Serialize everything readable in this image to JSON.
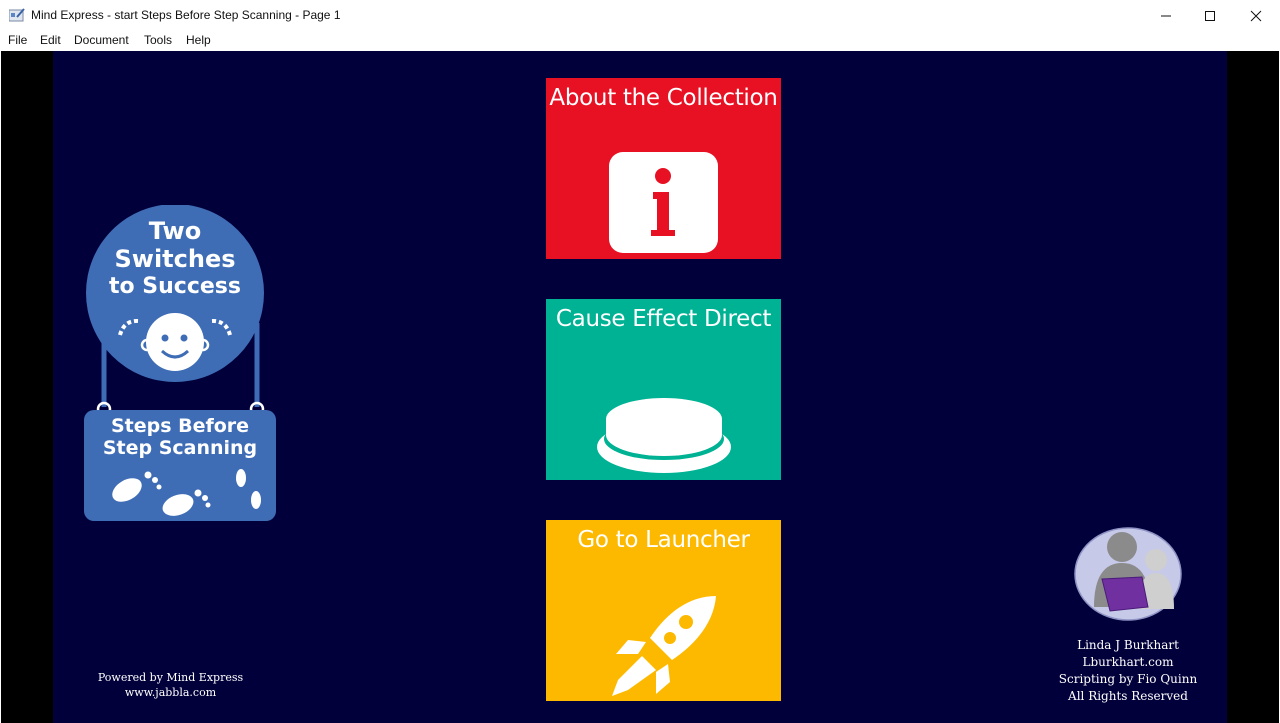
{
  "window": {
    "title": "Mind Express - start Steps Before Step Scanning - Page 1",
    "icon": "mind-express-app-icon",
    "controls": [
      "minimize",
      "maximize",
      "close"
    ]
  },
  "menu": {
    "items": [
      "File",
      "Edit",
      "Document",
      "Tools",
      "Help"
    ]
  },
  "logo_left": {
    "title_line1": "Two",
    "title_line2": "Switches",
    "title_line3": "to Success",
    "sign_line1": "Steps Before",
    "sign_line2": "Step Scanning"
  },
  "tiles": [
    {
      "label": "About the Collection",
      "color": "#e81123",
      "icon": "info-icon"
    },
    {
      "label": "Cause Effect Direct",
      "color": "#00b294",
      "icon": "switch-button-icon"
    },
    {
      "label": "Go to Launcher",
      "color": "#fdb900",
      "icon": "rocket-icon"
    }
  ],
  "footer_left": {
    "line1": "Powered by Mind Express",
    "line2": "www.jabbla.com"
  },
  "footer_right": {
    "line1": "Linda J Burkhart",
    "line2": "Lburkhart.com",
    "line3": "Scripting by Fio Quinn",
    "line4": "All Rights Reserved"
  },
  "colors": {
    "canvas_bg": "#02003a",
    "frame_bg": "#000000",
    "logo_blue": "#3f6db5"
  }
}
